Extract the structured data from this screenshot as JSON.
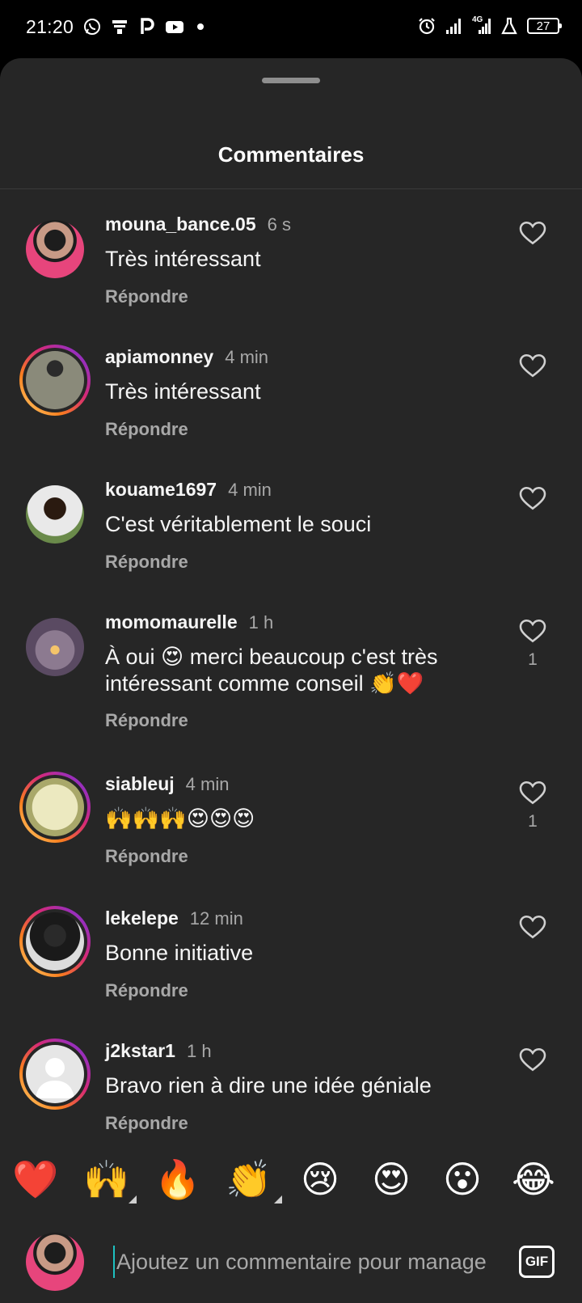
{
  "status_bar": {
    "time": "21:20",
    "left_icons": [
      "whatsapp-icon",
      "notification-icon",
      "parking-icon",
      "youtube-icon"
    ],
    "right_icons": [
      "alarm-icon",
      "signal-icon",
      "signal-4g-icon",
      "lab-flask-icon"
    ],
    "network": "4G",
    "battery": "27"
  },
  "sheet": {
    "title": "Commentaires"
  },
  "comments": [
    {
      "username": "mouna_bance.05",
      "time": "6 s",
      "text": "Très intéressant",
      "reply": "Répondre",
      "likes": "",
      "ring": false,
      "avatar_color": "#b63a60"
    },
    {
      "username": "apiamonney",
      "time": "4 min",
      "text": "Très intéressant",
      "reply": "Répondre",
      "likes": "",
      "ring": true,
      "avatar_color": "#6b6b55"
    },
    {
      "username": "kouame1697",
      "time": "4 min",
      "text": "C'est véritablement le souci",
      "reply": "Répondre",
      "likes": "",
      "ring": false,
      "avatar_color": "#3c2a1e"
    },
    {
      "username": "momomaurelle",
      "time": "1 h",
      "text": "À oui 😍 merci beaucoup c'est très intéressant comme conseil 👏❤️",
      "reply": "Répondre",
      "likes": "1",
      "ring": false,
      "avatar_color": "#6e5a7a"
    },
    {
      "username": "siableuj",
      "time": "4 min",
      "text": "🙌🙌🙌😍😍😍",
      "reply": "Répondre",
      "likes": "1",
      "ring": true,
      "avatar_color": "#c9c9a0"
    },
    {
      "username": "lekelepe",
      "time": "12 min",
      "text": "Bonne initiative",
      "reply": "Répondre",
      "likes": "",
      "ring": true,
      "avatar_color": "#d0d0d0"
    },
    {
      "username": "j2kstar1",
      "time": "1 h",
      "text": "Bravo rien à dire une idée géniale",
      "reply": "Répondre",
      "likes": "",
      "ring": true,
      "avatar_color": "#dcdcdc"
    }
  ],
  "reactions": [
    "❤️",
    "🙌",
    "🔥",
    "👏",
    "😢",
    "😍",
    "😮",
    "😂"
  ],
  "input": {
    "placeholder": "Ajoutez un commentaire pour manage",
    "gif_label": "GIF"
  },
  "colors": {
    "sheet_bg": "#262626",
    "status_bg": "#000000",
    "secondary_text": "#a8a8a8",
    "cursor": "#1ec0c0"
  }
}
